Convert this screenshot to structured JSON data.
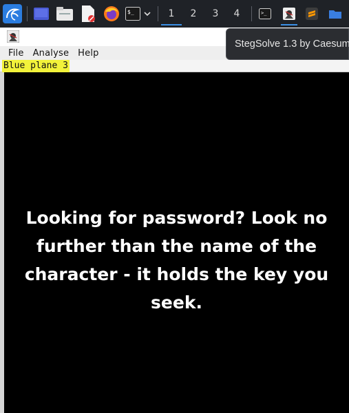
{
  "taskbar": {
    "workspaces": [
      "1",
      "2",
      "3",
      "4"
    ],
    "active_workspace": "1",
    "launchers": [
      "kali-menu-icon",
      "desktop-icon",
      "file-manager-icon",
      "text-editor-icon",
      "firefox-icon",
      "terminal-icon"
    ],
    "tasks": [
      "terminal-task-icon",
      "stegsolve-task-icon",
      "sublime-text-task-icon",
      "folder-task-icon"
    ]
  },
  "tooltip": {
    "text": "StegSolve 1.3 by Caesum"
  },
  "window": {
    "menu": [
      "File",
      "Analyse",
      "Help"
    ],
    "plane_label": "Blue plane 3",
    "message": "Looking for password? Look no further than the name of the character - it holds the key you seek."
  }
}
